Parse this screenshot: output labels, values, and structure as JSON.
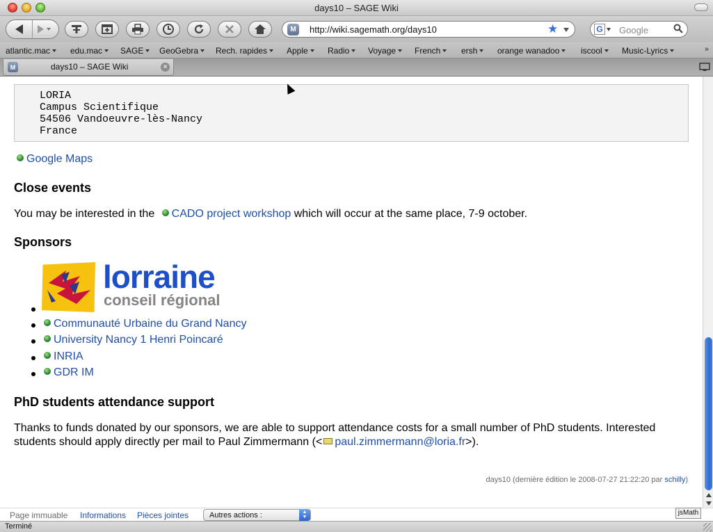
{
  "window": {
    "title": "days10 – SAGE Wiki"
  },
  "toolbar": {
    "back_icon": "back-arrow-icon",
    "forward_icon": "forward-arrow-icon",
    "buttons": [
      {
        "name": "add-bookmark",
        "icon": "add-bookmark-icon"
      },
      {
        "name": "new-tab",
        "icon": "new-tab-icon"
      },
      {
        "name": "print",
        "icon": "printer-icon"
      },
      {
        "name": "history",
        "icon": "clock-icon"
      },
      {
        "name": "reload",
        "icon": "reload-icon"
      },
      {
        "name": "stop",
        "icon": "stop-icon"
      },
      {
        "name": "home",
        "icon": "home-icon"
      }
    ],
    "url": "http://wiki.sagemath.org/days10",
    "site_icon_letter": "M",
    "search_engine_letter": "G",
    "search_placeholder": "Google"
  },
  "bookmarks": [
    "atlantic.mac",
    "edu.mac",
    "SAGE",
    "GeoGebra",
    "Rech. rapides",
    "Apple",
    "Radio",
    "Voyage",
    "French",
    "ersh",
    "orange wanadoo",
    "iscool",
    "Music-Lyrics"
  ],
  "bookmarks_more": "»",
  "tab": {
    "label": "days10 – SAGE Wiki",
    "icon_letter": "M"
  },
  "page": {
    "address_lines": [
      "LORIA",
      "Campus Scientifique",
      "54506 Vandoeuvre-lès-Nancy",
      "France"
    ],
    "google_maps_link": "Google Maps",
    "close_events_heading": "Close events",
    "close_events_pre": "You may be interested in the",
    "close_events_link": "CADO project workshop",
    "close_events_post": "which will occur at the same place, 7-9 october.",
    "sponsors_heading": "Sponsors",
    "logo_word": "lorraine",
    "logo_subtitle": "conseil régional",
    "sponsors": [
      "Communauté Urbaine du Grand Nancy",
      "University Nancy 1 Henri Poincaré",
      "INRIA",
      "GDR IM"
    ],
    "phd_heading": "PhD students attendance support",
    "phd_line1": "Thanks to funds donated by our sponsors, we are able to support attendance costs for a small number of PhD students. Interested",
    "phd_line2_pre": "students should apply directly per mail to Paul Zimmermann (<",
    "phd_email": "paul.zimmermann@loria.fr",
    "phd_line2_post": ">).",
    "edit_info": "days10 (dernière édition le 2008-07-27 21:22:20 par",
    "edit_user": "schilly",
    "edit_info_close": ")"
  },
  "wiki_footer": {
    "immutable": "Page immuable",
    "info": "Informations",
    "attachments": "Pièces jointes",
    "actions_select": "Autres actions :",
    "jsmath": "jsMath"
  },
  "status": {
    "text": "Terminé"
  },
  "colors": {
    "link": "#1f4ea8",
    "scroll_thumb": "#2f6cd0",
    "logo_blue": "#1e4fc7",
    "logo_yellow": "#f6c10f",
    "logo_gray": "#848484"
  }
}
